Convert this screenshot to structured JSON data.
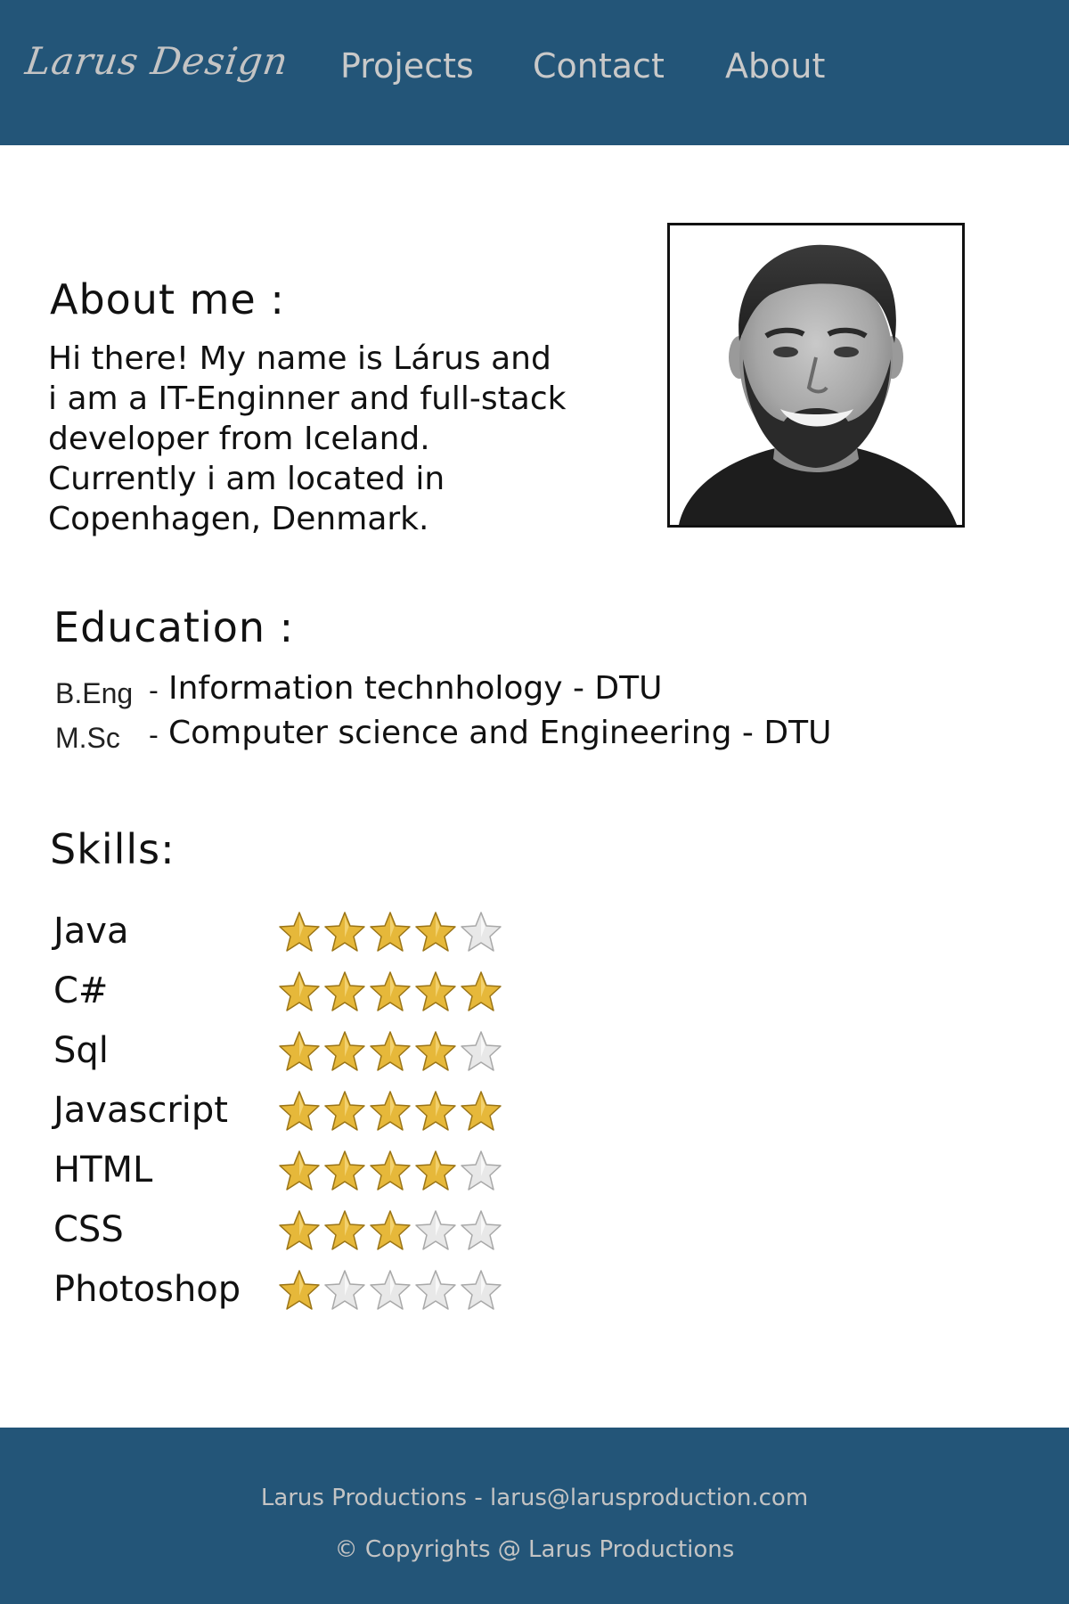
{
  "header": {
    "brand": "Larus Design",
    "nav": {
      "projects": "Projects",
      "contact": "Contact",
      "about": "About"
    }
  },
  "about": {
    "heading": "About me :",
    "lines": [
      "Hi there! My name is Lárus and",
      "i am a IT-Enginner and full-stack",
      "developer from Iceland.",
      "Currently i am located in",
      "Copenhagen, Denmark."
    ],
    "photo_icon": "profile-photo"
  },
  "education": {
    "heading": "Education :",
    "items": [
      {
        "degree": "B.Eng",
        "separator": "-",
        "description": "Information technhology - DTU"
      },
      {
        "degree": "M.Sc",
        "separator": "-",
        "description": "Computer science and Engineering - DTU"
      }
    ]
  },
  "skills": {
    "heading": "Skills:",
    "max_rating": 5,
    "items": [
      {
        "name": "Java",
        "rating": 4
      },
      {
        "name": "C#",
        "rating": 5
      },
      {
        "name": "Sql",
        "rating": 4
      },
      {
        "name": "Javascript",
        "rating": 5
      },
      {
        "name": "HTML",
        "rating": 4
      },
      {
        "name": "CSS",
        "rating": 3
      },
      {
        "name": "Photoshop",
        "rating": 1
      }
    ]
  },
  "footer": {
    "contact": "Larus Productions - larus@larusproduction.com",
    "copyright": "© Copyrights @ Larus Productions"
  },
  "colors": {
    "header_bg": "#235578",
    "footer_bg": "#235578",
    "nav_text": "#c9c9c9",
    "star_filled": "#e6b83a",
    "star_empty": "#e8e8e8"
  }
}
